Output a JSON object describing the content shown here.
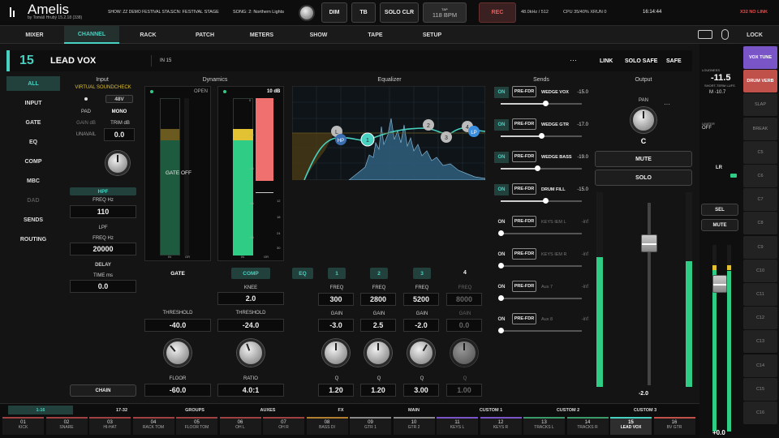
{
  "app": {
    "name": "Amelis",
    "sub": "by Tomáš Hrubý  15.2.18 (338)"
  },
  "top": {
    "show": "SHOW: ZZ DEMO FESTIVAL STA...",
    "scene": "SCN: FESTIVAL STAGE",
    "song": "SONG: 2: Northern Lights",
    "dim": "DIM",
    "tb": "TB",
    "solo_clr": "SOLO CLR",
    "tap": "TAP",
    "bpm": "118 BPM",
    "rec": "REC",
    "rate": "48.0kHz / 512",
    "cpu": "CPU 35/40%  XRUN 0",
    "time": "16:14:44",
    "alert": "X32 NO LINK"
  },
  "tabs": [
    "MIXER",
    "CHANNEL",
    "RACK",
    "PATCH",
    "METERS",
    "SHOW",
    "TAPE",
    "SETUP"
  ],
  "lock": "LOCK",
  "strip": {
    "num": "15",
    "name": "LEAD VOX",
    "in_label": "IN  15",
    "more": "···",
    "link": "LINK",
    "solo_safe": "SOLO SAFE",
    "safe": "SAFE"
  },
  "nav": [
    "ALL",
    "INPUT",
    "GATE",
    "EQ",
    "COMP",
    "MBC",
    "DAD",
    "SENDS",
    "ROUTING"
  ],
  "input": {
    "header": "Input",
    "virtual": "VIRTUAL SOUNDCHECK",
    "phantom": "48V",
    "pad": "PAD",
    "mono": "MONO",
    "gain_label": "GAIN dB",
    "trim_label": "TRIM dB",
    "gain": "UNAVAIL",
    "trim": "0.0",
    "hpf": "HPF",
    "hpf_freq_label": "FREQ Hz",
    "hpf_freq": "110",
    "lpf": "LPF",
    "lpf_freq_label": "FREQ Hz",
    "lpf_freq": "20000",
    "delay": "DELAY",
    "delay_label": "TIME ms",
    "delay_time": "0.0",
    "chain": "CHAIN"
  },
  "dynamics": {
    "header": "Dynamics",
    "gate_state": "OPEN",
    "gate_off": "GATE OFF",
    "comp_db": "10 dB",
    "gate_label": "GATE",
    "comp_label": "COMP",
    "knee_label": "KNEE",
    "knee": "2.0",
    "thr_label_g": "THRESHOLD",
    "gate_threshold": "-40.0",
    "thr_label_c": "THRESHOLD",
    "comp_threshold": "-24.0",
    "floor_label": "FLOOR",
    "floor": "-60.0",
    "ratio_label": "RATIO",
    "ratio": "4.0:1",
    "gate_in": "IN",
    "gate_gr": "GR",
    "comp_in": "IN",
    "comp_gr": "GR",
    "scale": [
      "0",
      "-12",
      "-24",
      "-36",
      "-48"
    ],
    "grscale": [
      "0",
      "6",
      "12",
      "18",
      "24",
      "30"
    ]
  },
  "eq": {
    "header": "Equalizer",
    "eq_btn": "EQ",
    "bands": [
      {
        "num": "1",
        "freq": "300",
        "gain": "-3.0",
        "q": "1.20"
      },
      {
        "num": "2",
        "freq": "2800",
        "gain": "2.5",
        "q": "1.20"
      },
      {
        "num": "3",
        "freq": "5200",
        "gain": "-2.0",
        "q": "3.00"
      },
      {
        "num": "4",
        "freq": "8000",
        "gain": "0.0",
        "q": "1.00"
      }
    ],
    "freq_label": "FREQ",
    "gain_label": "GAIN",
    "q_label": "Q",
    "nodes": [
      "L",
      "HP",
      "1",
      "2",
      "3",
      "4",
      "LP"
    ]
  },
  "sends": {
    "header": "Sends",
    "items": [
      {
        "on": "ON",
        "mode": "PRE-FDR",
        "name": "WEDGE VOX",
        "val": "-15.0",
        "level": 0.55,
        "active": true
      },
      {
        "on": "ON",
        "mode": "PRE-FDR",
        "name": "WEDGE GTR",
        "val": "-17.0",
        "level": 0.5,
        "active": true
      },
      {
        "on": "ON",
        "mode": "PRE-FDR",
        "name": "WEDGE BASS",
        "val": "-19.0",
        "level": 0.45,
        "active": true
      },
      {
        "on": "ON",
        "mode": "PRE-FDR",
        "name": "DRUM FILL",
        "val": "-15.0",
        "level": 0.55,
        "active": true
      },
      {
        "on": "ON",
        "mode": "PRE-FDR",
        "name": "KEYS IEM L",
        "val": "-inf",
        "level": 0,
        "active": false
      },
      {
        "on": "ON",
        "mode": "PRE-FDR",
        "name": "KEYS IEM R",
        "val": "-inf",
        "level": 0,
        "active": false
      },
      {
        "on": "ON",
        "mode": "PRE-FDR",
        "name": "Aux 7",
        "val": "-inf",
        "level": 0,
        "active": false
      },
      {
        "on": "ON",
        "mode": "PRE-FDR",
        "name": "Aux 8",
        "val": "-inf",
        "level": 0,
        "active": false
      }
    ]
  },
  "output": {
    "header": "Output",
    "pan_label": "PAN",
    "pan": "C",
    "mute": "MUTE",
    "solo": "SOLO",
    "fader_val": "-2.0",
    "fader_level": 0.78,
    "more": "···"
  },
  "bottom": {
    "tabs": [
      "1-16",
      "17-32",
      "GROUPS",
      "AUXES",
      "FX",
      "MAIN",
      "CUSTOM 1",
      "CUSTOM 2",
      "CUSTOM 3"
    ],
    "channels": [
      {
        "n": "01",
        "t": "KICK"
      },
      {
        "n": "02",
        "t": "SNARE"
      },
      {
        "n": "03",
        "t": "HI-HAT"
      },
      {
        "n": "04",
        "t": "RACK TOM"
      },
      {
        "n": "05",
        "t": "FLOOR TOM"
      },
      {
        "n": "06",
        "t": "OH L"
      },
      {
        "n": "07",
        "t": "OH R"
      },
      {
        "n": "08",
        "t": "BASS DI"
      },
      {
        "n": "09",
        "t": "GTR 1"
      },
      {
        "n": "10",
        "t": "GTR 2"
      },
      {
        "n": "11",
        "t": "KEYS L"
      },
      {
        "n": "12",
        "t": "KEYS R"
      },
      {
        "n": "13",
        "t": "TRACKS L"
      },
      {
        "n": "14",
        "t": "TRACKS R"
      },
      {
        "n": "15",
        "t": "LEAD VOX"
      },
      {
        "n": "16",
        "t": "BV GTR"
      }
    ]
  },
  "right": {
    "loudness": "LOUDNESS",
    "lufs": "-11.5",
    "lufs_label": "SHORT-TERM LUFS",
    "m": "M  -10.7",
    "limiter": "LIMITER",
    "limiter_val": "OFF",
    "lr": "LR",
    "sel": "SEL",
    "mute": "MUTE",
    "main_val": "+0.0",
    "ch": [
      "VOX TUNE",
      "DRUM VERB",
      "SLAP",
      "BREAK",
      "C5",
      "C6",
      "C7",
      "C8",
      "C9",
      "C10",
      "C11",
      "C12",
      "C13",
      "C14",
      "C15",
      "C16"
    ]
  },
  "colors": {
    "accent": "#48d1c0",
    "rec": "#c0392b",
    "meter_green": "#2ecc85",
    "meter_yellow": "#e2c233",
    "meter_red": "#f07070",
    "purple": "#7a55c8",
    "red": "#c0504a"
  }
}
